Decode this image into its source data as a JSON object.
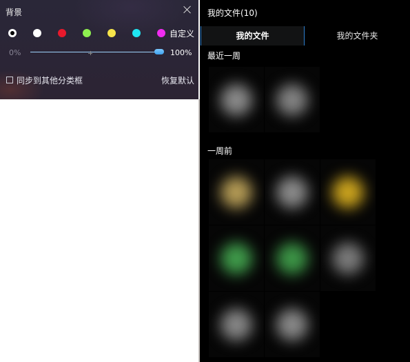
{
  "background_panel": {
    "title": "背景",
    "swatches": [
      {
        "name": "black",
        "color": "#000000",
        "selected": true
      },
      {
        "name": "white",
        "color": "#ffffff"
      },
      {
        "name": "red",
        "color": "#e8192c"
      },
      {
        "name": "green",
        "color": "#8ef050"
      },
      {
        "name": "yellow",
        "color": "#f6e44a"
      },
      {
        "name": "cyan",
        "color": "#1fe6f2"
      },
      {
        "name": "magenta",
        "color": "#f02cf0"
      }
    ],
    "custom_label": "自定义",
    "opacity": {
      "min_label": "0%",
      "max_label": "100%",
      "value": 1.0
    },
    "sync_label": "同步到其他分类框",
    "sync_checked": false,
    "restore_label": "恢复默认"
  },
  "files_panel": {
    "header": "我的文件(10)",
    "tabs": [
      {
        "label": "我的文件",
        "active": true
      },
      {
        "label": "我的文件夹",
        "active": false
      }
    ],
    "sections": [
      {
        "title": "最近一周",
        "thumbnail_colors": [
          "#8a8a8a",
          "#828282"
        ]
      },
      {
        "title": "一周前",
        "thumbnail_colors": [
          "#b39a55",
          "#8a8a8a",
          "#c9a21e",
          "#3f9a4a",
          "#3c9446",
          "#7a7a7a",
          "#868686",
          "#888888"
        ]
      }
    ]
  }
}
